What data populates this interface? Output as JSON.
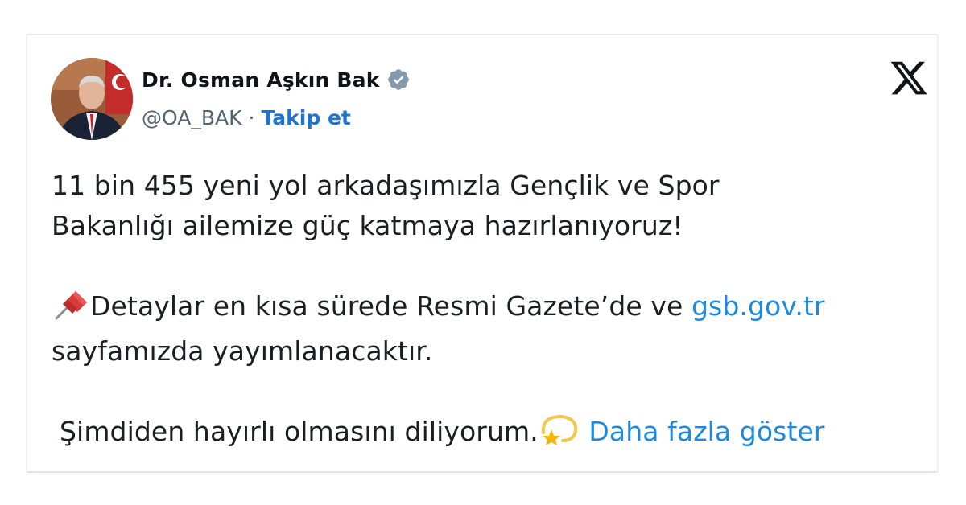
{
  "tweet": {
    "author": {
      "display_name": "Dr. Osman Aşkın Bak",
      "handle": "@OA_BAK",
      "verified": true,
      "avatar_icon": "profile-photo"
    },
    "separator": "·",
    "follow_label": "Takip et",
    "platform_icon": "x-logo-icon",
    "text": {
      "line1": "11 bin 455 yeni yol arkadaşımızla Gençlik ve Spor",
      "line2": "Bakanlığı ailemize güç katmaya hazırlanıyoruz!",
      "line3_pre": "Detaylar en kısa sürede Resmi Gazete’de ve ",
      "link": "gsb.gov.tr",
      "line4": "sayfamızda yayımlanacaktır.",
      "line5": "Şimdiden hayırlı olmasını diliyorum.",
      "pin_emoji": "pushpin-icon",
      "star_emoji": "dizzy-star-icon"
    },
    "show_more_label": "Daha fazla göster"
  },
  "colors": {
    "link": "#1d8ae0",
    "follow": "#1d74d4",
    "text": "#1b1f23",
    "muted": "#536471",
    "verified_badge": "#829aab"
  }
}
